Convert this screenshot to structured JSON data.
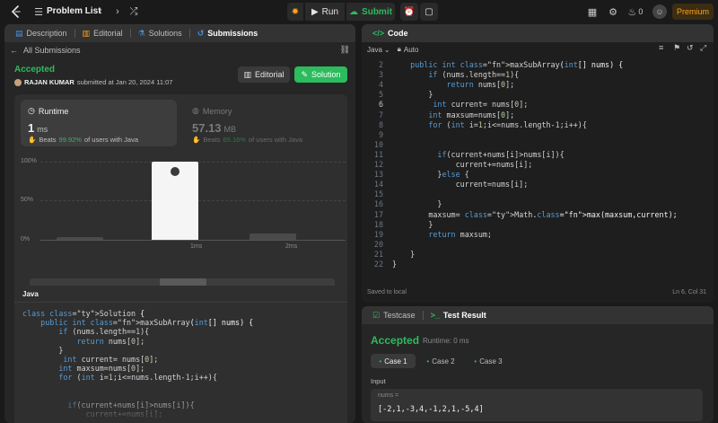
{
  "topbar": {
    "problem_list_label": "Problem List",
    "run_label": "Run",
    "submit_label": "Submit",
    "streak_count": "0",
    "premium_label": "Premium"
  },
  "left_tabs": [
    {
      "label": "Description",
      "active": false
    },
    {
      "label": "Editorial",
      "active": false
    },
    {
      "label": "Solutions",
      "active": false
    },
    {
      "label": "Submissions",
      "active": true
    }
  ],
  "submission": {
    "back_label": "All Submissions",
    "status": "Accepted",
    "user": "RAJAN KUMAR",
    "submitted_text": "submitted at Jan 20, 2024 11:07",
    "editorial_button": "Editorial",
    "solution_button": "Solution",
    "runtime": {
      "title": "Runtime",
      "value": "1",
      "unit": "ms",
      "beats_prefix": "Beats",
      "beats_pct": "99.92%",
      "beats_suffix": "of users with Java"
    },
    "memory": {
      "title": "Memory",
      "value": "57.13",
      "unit": "MB",
      "beats_prefix": "Beats",
      "beats_pct": "65.16%",
      "beats_suffix": "of users with Java"
    }
  },
  "chart_data": {
    "type": "bar",
    "categories": [
      "",
      "1ms",
      "2ms"
    ],
    "values": [
      3,
      99.92,
      8
    ],
    "ylim": [
      0,
      100
    ],
    "ytick_labels": [
      "100%",
      "50%",
      "0%"
    ],
    "minimap_labels": [
      "1ms",
      "2ms"
    ],
    "highlight_index": 1
  },
  "code_block": {
    "language": "Java",
    "lines": [
      "class Solution {",
      "    public int maxSubArray(int[] nums) {",
      "        if (nums.length==1){",
      "            return nums[0];",
      "        }",
      "         int current= nums[0];",
      "        int maxsum=nums[0];",
      "        for (int i=1;i<=nums.length-1;i++){",
      "",
      "",
      "          if(current+nums[i]>nums[i]){",
      "              current+=nums[i];"
    ]
  },
  "editor": {
    "tab_label": "Code",
    "language": "Java",
    "auto_label": "Auto",
    "status_left": "Saved to local",
    "status_right": "Ln 6, Col 31",
    "lines": [
      {
        "n": "2",
        "text": "    public int maxSubArray(int[] nums) {"
      },
      {
        "n": "3",
        "text": "        if (nums.length==1){"
      },
      {
        "n": "4",
        "text": "            return nums[0];"
      },
      {
        "n": "5",
        "text": "        }"
      },
      {
        "n": "6",
        "text": "         int current= nums[0];"
      },
      {
        "n": "7",
        "text": "        int maxsum=nums[0];"
      },
      {
        "n": "8",
        "text": "        for (int i=1;i<=nums.length-1;i++){"
      },
      {
        "n": "9",
        "text": ""
      },
      {
        "n": "10",
        "text": ""
      },
      {
        "n": "11",
        "text": "          if(current+nums[i]>nums[i]){"
      },
      {
        "n": "12",
        "text": "              current+=nums[i];"
      },
      {
        "n": "13",
        "text": "          }else {"
      },
      {
        "n": "14",
        "text": "              current=nums[i];"
      },
      {
        "n": "15",
        "text": ""
      },
      {
        "n": "16",
        "text": "          }"
      },
      {
        "n": "17",
        "text": "        maxsum= Math.max(maxsum,current);"
      },
      {
        "n": "18",
        "text": "        }"
      },
      {
        "n": "19",
        "text": "        return maxsum;"
      },
      {
        "n": "20",
        "text": ""
      },
      {
        "n": "21",
        "text": "    }"
      },
      {
        "n": "22",
        "text": "}"
      }
    ]
  },
  "test_panel": {
    "tab_testcase": "Testcase",
    "tab_result": "Test Result",
    "status": "Accepted",
    "runtime_text": "Runtime: 0 ms",
    "cases": [
      "Case 1",
      "Case 2",
      "Case 3"
    ],
    "input_label": "Input",
    "var_name": "nums =",
    "var_value": "[-2,1,-3,4,-1,2,1,-5,4]"
  },
  "colors": {
    "accent_green": "#2cbb5d",
    "premium_orange": "#ffa116",
    "panel_bg": "#262626"
  }
}
